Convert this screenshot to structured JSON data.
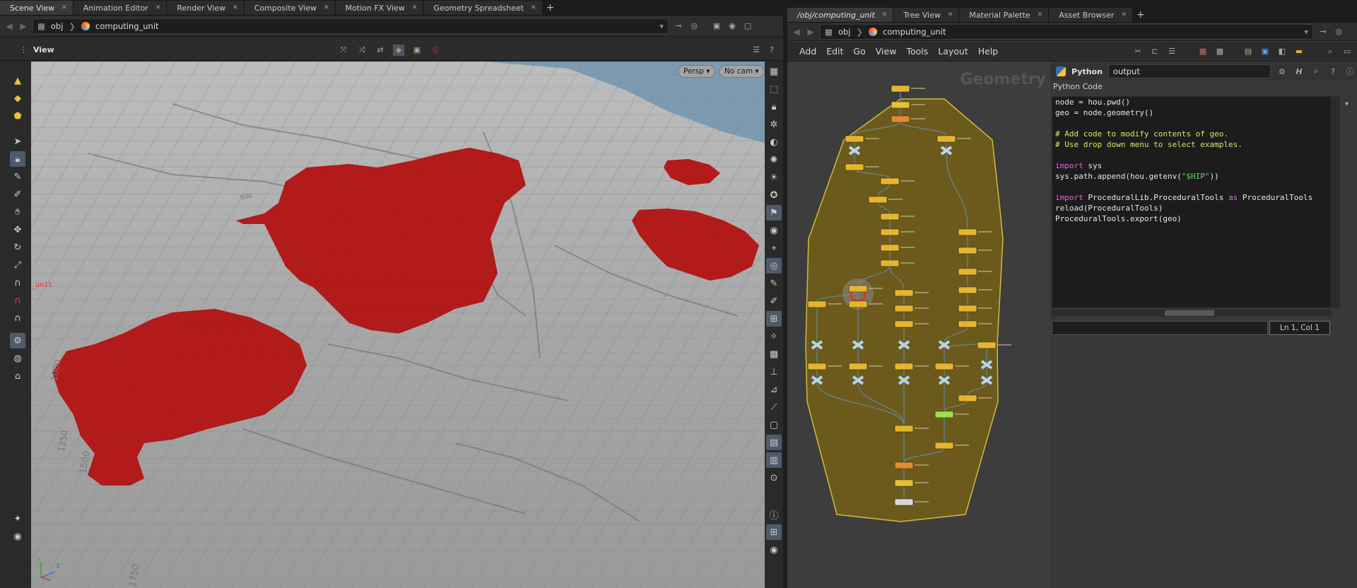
{
  "left_tabs": [
    {
      "label": "Scene View",
      "active": true
    },
    {
      "label": "Animation Editor",
      "active": false
    },
    {
      "label": "Render View",
      "active": false
    },
    {
      "label": "Composite View",
      "active": false
    },
    {
      "label": "Motion FX View",
      "active": false
    },
    {
      "label": "Geometry Spreadsheet",
      "active": false
    }
  ],
  "left_path": {
    "root": "obj",
    "node": "computing_unit"
  },
  "viewport": {
    "title": "View",
    "persp_label": "Persp ▾",
    "cam_label": "No cam ▾",
    "overlay_label": "_unit",
    "grid_numbers": [
      "500",
      "1000",
      "1250",
      "1500",
      "1750"
    ],
    "axis_y": "y",
    "axis_z": "z"
  },
  "right_tabs": [
    {
      "label": "/obj/computing_unit",
      "active": true
    },
    {
      "label": "Tree View",
      "active": false
    },
    {
      "label": "Material Palette",
      "active": false
    },
    {
      "label": "Asset Browser",
      "active": false
    }
  ],
  "right_path": {
    "root": "obj",
    "node": "computing_unit"
  },
  "menu": [
    "Add",
    "Edit",
    "Go",
    "View",
    "Tools",
    "Layout",
    "Help"
  ],
  "network": {
    "watermark": "Geometry"
  },
  "python": {
    "header_label": "Python",
    "node_name": "output",
    "section_label": "Python Code",
    "code_lines": [
      [
        {
          "t": "node = hou.pwd()",
          "c": ""
        }
      ],
      [
        {
          "t": "geo = node.geometry()",
          "c": ""
        }
      ],
      [
        {
          "t": "",
          "c": ""
        }
      ],
      [
        {
          "t": "# Add code to modify contents of geo.",
          "c": "cm"
        }
      ],
      [
        {
          "t": "# Use drop down menu to select examples.",
          "c": "cm"
        }
      ],
      [
        {
          "t": "",
          "c": ""
        }
      ],
      [
        {
          "t": "import",
          "c": "kw"
        },
        {
          "t": " sys",
          "c": ""
        }
      ],
      [
        {
          "t": "sys.path.append(hou.getenv(",
          "c": ""
        },
        {
          "t": "\"$HIP\"",
          "c": "st"
        },
        {
          "t": "))",
          "c": ""
        }
      ],
      [
        {
          "t": "",
          "c": ""
        }
      ],
      [
        {
          "t": "import",
          "c": "kw"
        },
        {
          "t": " ProceduralLib.ProceduralTools ",
          "c": ""
        },
        {
          "t": "as",
          "c": "kw"
        },
        {
          "t": " ProceduralTools",
          "c": ""
        }
      ],
      [
        {
          "t": "reload(ProceduralTools)",
          "c": ""
        }
      ],
      [
        {
          "t": "ProceduralTools.export(geo)",
          "c": ""
        }
      ]
    ],
    "cursor_status": "Ln 1, Col 1"
  },
  "colors": {
    "terrain": "#9c9c9c",
    "red_region": "#b51a1a",
    "water": "#7d9db3",
    "network_box": "#6f5c1c",
    "network_box_border": "#d8c23a",
    "node_yellow": "#e6b52c"
  }
}
